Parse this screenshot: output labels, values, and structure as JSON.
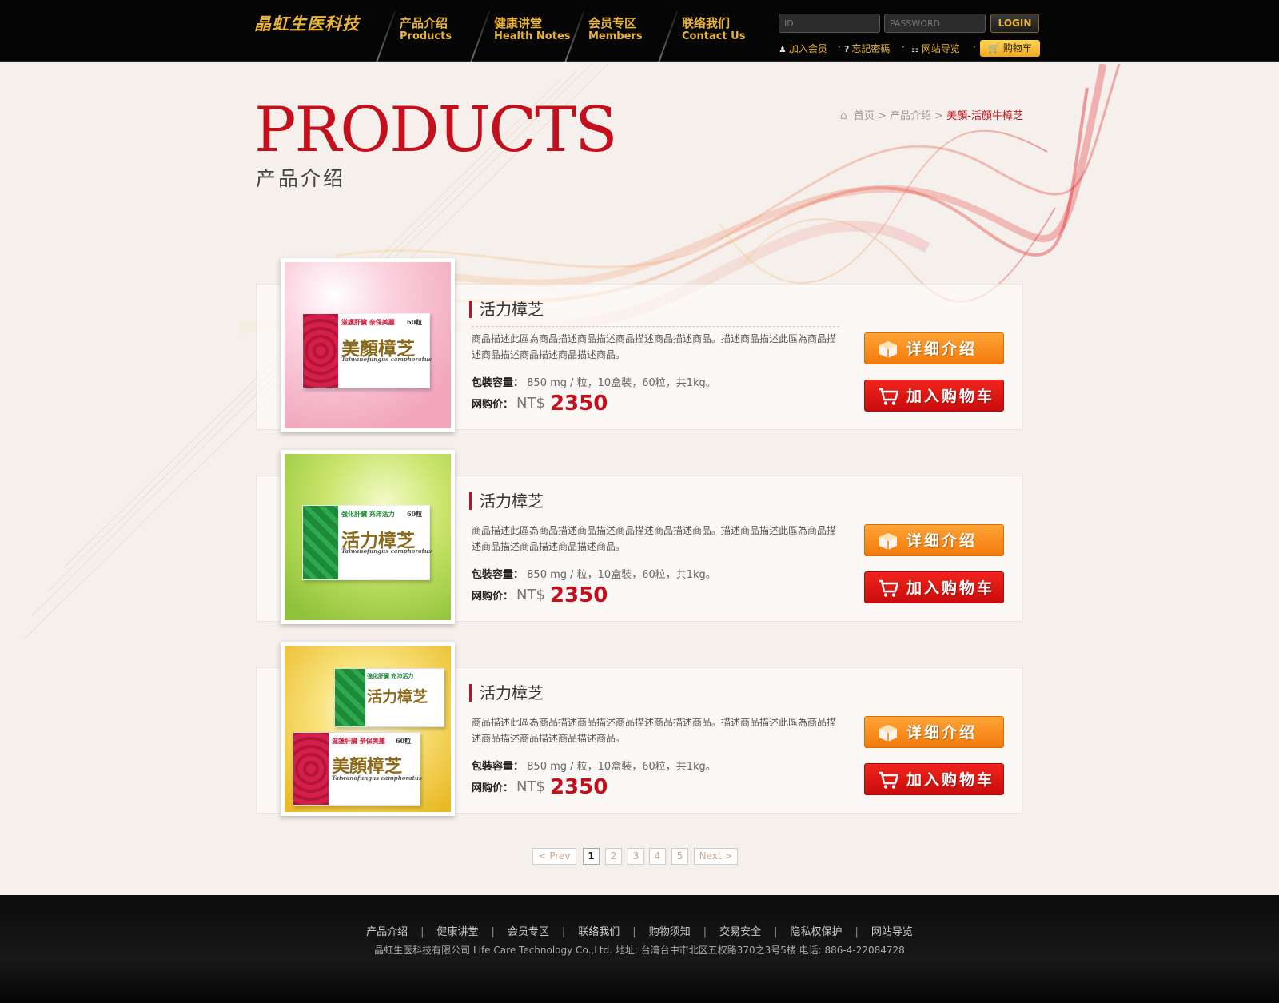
{
  "header": {
    "logo": "晶虹生医科技",
    "nav": [
      {
        "zh": "产品介绍",
        "en": "Products"
      },
      {
        "zh": "健康讲堂",
        "en": "Health Notes"
      },
      {
        "zh": "会员专区",
        "en": "Members"
      },
      {
        "zh": "联络我们",
        "en": "Contact Us"
      }
    ],
    "id_placeholder": "ID",
    "password_placeholder": "PASSWORD",
    "login_label": "LOGIN",
    "links": {
      "join": "加入会员",
      "forgot": "忘記密碼",
      "sitemap": "网站导览",
      "sep": "·"
    },
    "cart_label": "购物车"
  },
  "page": {
    "title_en": "PRODUCTS",
    "title_zh": "产品介绍"
  },
  "breadcrumb": {
    "home": "首页",
    "sep": ">",
    "section": "产品介绍",
    "current": "美顏-活顏牛樟芝"
  },
  "products": [
    {
      "name": "活力樟芝",
      "desc": "商品描述此區為商品描述商品描述商品描述商品描述商品。描述商品描述此區為商品描述商品描述商品描述商品描述商品。",
      "spec_label": "包裝容量：",
      "spec": "850 mg / 粒，10盒裝，60粒，共1kg。",
      "price_label": "网购价：",
      "currency": "NT$",
      "price": "2350",
      "detail_label": "详细介绍",
      "cart_label": "加入购物车",
      "image": {
        "theme": "pink",
        "box_title": "美顏樟芝",
        "box_sub": "Taiwanofungus camphoratus",
        "box_tag": "滋護肝臟 亲保美麗",
        "box_count": "60粒",
        "bg_color": "#f6b7c9",
        "accent": "#d2204a"
      }
    },
    {
      "name": "活力樟芝",
      "desc": "商品描述此區為商品描述商品描述商品描述商品描述商品。描述商品描述此區為商品描述商品描述商品描述商品描述商品。",
      "spec_label": "包裝容量：",
      "spec": "850 mg / 粒，10盒裝，60粒，共1kg。",
      "price_label": "网购价：",
      "currency": "NT$",
      "price": "2350",
      "detail_label": "详细介绍",
      "cart_label": "加入购物车",
      "image": {
        "theme": "green",
        "box_title": "活力樟芝",
        "box_sub": "Taiwanofungus camphoratus",
        "box_tag": "強化肝臟 充沛活力",
        "box_count": "60粒",
        "bg_color": "#b5d94a",
        "accent": "#1d8a3a"
      }
    },
    {
      "name": "活力樟芝",
      "desc": "商品描述此區為商品描述商品描述商品描述商品描述商品。描述商品描述此區為商品描述商品描述商品描述商品描述商品。",
      "spec_label": "包裝容量：",
      "spec": "850 mg / 粒，10盒裝，60粒，共1kg。",
      "price_label": "网购价：",
      "currency": "NT$",
      "price": "2350",
      "detail_label": "详细介绍",
      "cart_label": "加入购物车",
      "image": {
        "theme": "gold",
        "box_title": "活力樟芝",
        "box_title2": "美顏樟芝",
        "box_sub": "Taiwanofungus camphoratus",
        "box_tag": "強化肝臟 充沛活力",
        "box_tag2": "滋護肝臟 亲保美麗",
        "box_count": "60粒",
        "bg_color": "#f5d64a",
        "accent": "#1d8a3a"
      }
    }
  ],
  "pagination": {
    "prev": "< Prev",
    "pages": [
      "1",
      "2",
      "3",
      "4",
      "5"
    ],
    "current": "1",
    "next": "Next >"
  },
  "footer": {
    "links": [
      "产品介绍",
      "健康讲堂",
      "会员专区",
      "联络我们",
      "购物须知",
      "交易安全",
      "隐私权保护",
      "网站导览"
    ],
    "sep": "|",
    "info": "晶虹生医科技有限公司   Life Care Technology Co.,Ltd. 地址: 台湾台中市北区五权路370之3号5楼    电话: 886-4-22084728"
  },
  "colors": {
    "accent_red": "#c4101c",
    "gold": "#e8b43a",
    "orange_button": "#f27a0c",
    "red_button": "#c80c0c"
  }
}
